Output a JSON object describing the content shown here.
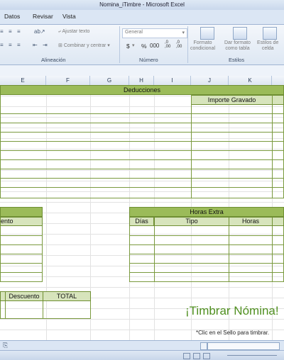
{
  "window": {
    "title": "Nomina_iTimbre  -  Microsoft Excel"
  },
  "ribbon": {
    "tabs": [
      "Datos",
      "Revisar",
      "Vista"
    ],
    "alignment": {
      "wrap_text": "Ajustar texto",
      "merge_center": "Combinar y centrar",
      "group_label": "Alineación"
    },
    "number": {
      "format_value": "General",
      "currency": "$",
      "percent": "%",
      "thousands": "000",
      "dec_inc": ",0\n,00",
      "group_label": "Número"
    },
    "styles": {
      "conditional_format": "Formato\ncondicional",
      "format_as_table": "Dar formato\ncomo tabla",
      "cell_styles": "Estilos de\ncelda",
      "group_label": "Estilos"
    }
  },
  "columns": [
    "E",
    "F",
    "G",
    "H",
    "I",
    "J",
    "K"
  ],
  "sheet": {
    "deductions_header": "Deducciones",
    "importe_gravado": "Importe Gravado",
    "left_table_sub": "ento",
    "overtime_header": "Horas Extra",
    "overtime_cols": [
      "Días",
      "Tipo",
      "Horas"
    ],
    "totals_cols": [
      "Descuento",
      "TOTAL"
    ],
    "stamp_title": "¡Timbrar Nómina!",
    "stamp_hint": "*Clic en el Sello para timbrar."
  }
}
